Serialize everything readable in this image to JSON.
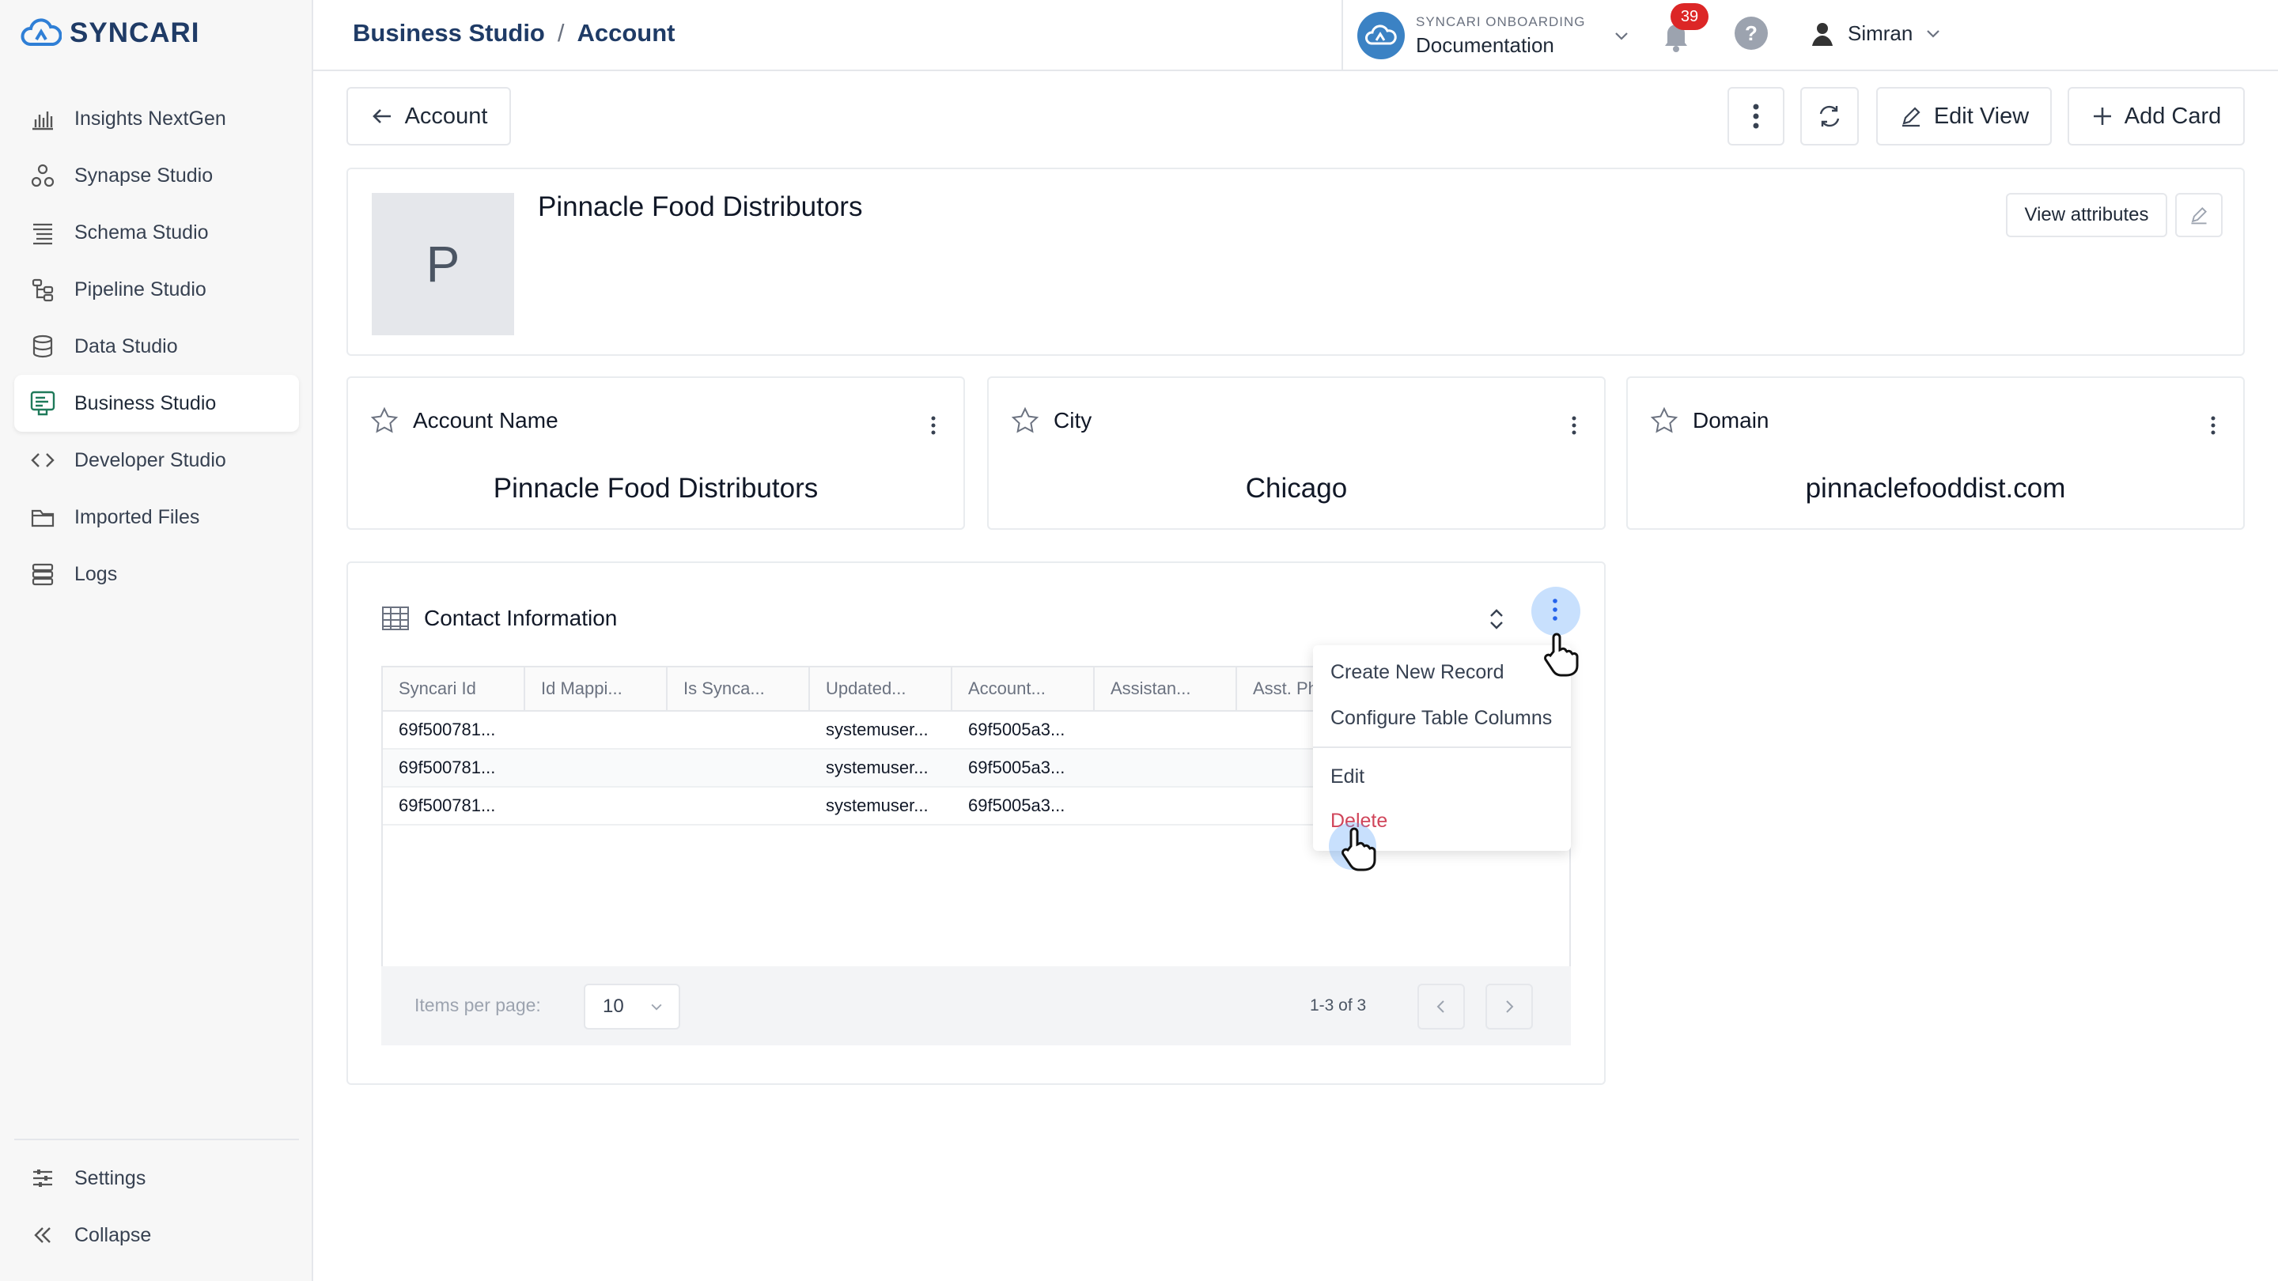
{
  "brand": {
    "name": "SYNCARI",
    "color": "#1f3b66"
  },
  "sidebar": {
    "items": [
      {
        "label": "Insights NextGen",
        "icon": "bar-chart-icon"
      },
      {
        "label": "Synapse Studio",
        "icon": "synapse-icon"
      },
      {
        "label": "Schema Studio",
        "icon": "schema-icon"
      },
      {
        "label": "Pipeline Studio",
        "icon": "pipeline-icon"
      },
      {
        "label": "Data Studio",
        "icon": "database-icon"
      },
      {
        "label": "Business Studio",
        "icon": "business-icon",
        "active": true
      },
      {
        "label": "Developer Studio",
        "icon": "code-icon"
      },
      {
        "label": "Imported Files",
        "icon": "folder-icon"
      },
      {
        "label": "Logs",
        "icon": "logs-icon"
      }
    ],
    "bottom": [
      {
        "label": "Settings",
        "icon": "sliders-icon"
      },
      {
        "label": "Collapse",
        "icon": "double-chevron-left-icon"
      }
    ]
  },
  "header": {
    "breadcrumb": [
      "Business Studio",
      "Account"
    ],
    "separator": "/",
    "org_label": "SYNCARI ONBOARDING",
    "org_name": "Documentation",
    "notifications": "39",
    "user": "Simran"
  },
  "toolbar": {
    "back_label": "Account",
    "edit_view": "Edit View",
    "add_card": "Add Card"
  },
  "record": {
    "initial": "P",
    "name": "Pinnacle Food Distributors",
    "view_attributes": "View attributes"
  },
  "attributes": [
    {
      "label": "Account Name",
      "value": "Pinnacle Food Distributors"
    },
    {
      "label": "City",
      "value": "Chicago"
    },
    {
      "label": "Domain",
      "value": "pinnaclefooddist.com"
    }
  ],
  "contact_table": {
    "title": "Contact Information",
    "columns": [
      "Syncari Id",
      "Id Mappi...",
      "Is Synca...",
      "Updated...",
      "Account...",
      "Assistan...",
      "Asst. Ph..."
    ],
    "rows": [
      [
        "69f500781...",
        "",
        "",
        "systemuser...",
        "69f5005a3...",
        "",
        ""
      ],
      [
        "69f500781...",
        "",
        "",
        "systemuser...",
        "69f5005a3...",
        "",
        ""
      ],
      [
        "69f500781...",
        "",
        "",
        "systemuser...",
        "69f5005a3...",
        "",
        ""
      ]
    ],
    "items_per_page_label": "Items per page:",
    "items_per_page": "10",
    "range": "1-3 of 3"
  },
  "menu": {
    "items": [
      "Create New Record",
      "Configure Table Columns",
      "Edit",
      "Delete"
    ],
    "delete_color": "#d0455a"
  }
}
